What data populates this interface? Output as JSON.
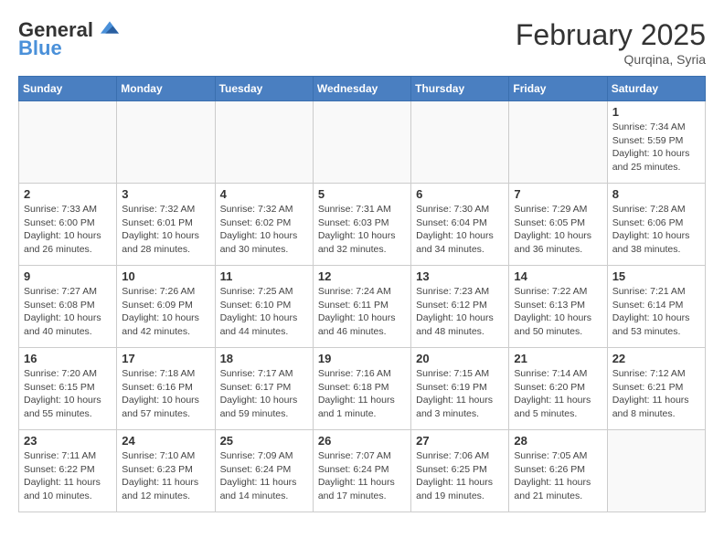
{
  "header": {
    "logo_line1": "General",
    "logo_line2": "Blue",
    "month_title": "February 2025",
    "location": "Qurqina, Syria"
  },
  "weekdays": [
    "Sunday",
    "Monday",
    "Tuesday",
    "Wednesday",
    "Thursday",
    "Friday",
    "Saturday"
  ],
  "weeks": [
    [
      {
        "day": "",
        "info": ""
      },
      {
        "day": "",
        "info": ""
      },
      {
        "day": "",
        "info": ""
      },
      {
        "day": "",
        "info": ""
      },
      {
        "day": "",
        "info": ""
      },
      {
        "day": "",
        "info": ""
      },
      {
        "day": "1",
        "info": "Sunrise: 7:34 AM\nSunset: 5:59 PM\nDaylight: 10 hours and 25 minutes."
      }
    ],
    [
      {
        "day": "2",
        "info": "Sunrise: 7:33 AM\nSunset: 6:00 PM\nDaylight: 10 hours and 26 minutes."
      },
      {
        "day": "3",
        "info": "Sunrise: 7:32 AM\nSunset: 6:01 PM\nDaylight: 10 hours and 28 minutes."
      },
      {
        "day": "4",
        "info": "Sunrise: 7:32 AM\nSunset: 6:02 PM\nDaylight: 10 hours and 30 minutes."
      },
      {
        "day": "5",
        "info": "Sunrise: 7:31 AM\nSunset: 6:03 PM\nDaylight: 10 hours and 32 minutes."
      },
      {
        "day": "6",
        "info": "Sunrise: 7:30 AM\nSunset: 6:04 PM\nDaylight: 10 hours and 34 minutes."
      },
      {
        "day": "7",
        "info": "Sunrise: 7:29 AM\nSunset: 6:05 PM\nDaylight: 10 hours and 36 minutes."
      },
      {
        "day": "8",
        "info": "Sunrise: 7:28 AM\nSunset: 6:06 PM\nDaylight: 10 hours and 38 minutes."
      }
    ],
    [
      {
        "day": "9",
        "info": "Sunrise: 7:27 AM\nSunset: 6:08 PM\nDaylight: 10 hours and 40 minutes."
      },
      {
        "day": "10",
        "info": "Sunrise: 7:26 AM\nSunset: 6:09 PM\nDaylight: 10 hours and 42 minutes."
      },
      {
        "day": "11",
        "info": "Sunrise: 7:25 AM\nSunset: 6:10 PM\nDaylight: 10 hours and 44 minutes."
      },
      {
        "day": "12",
        "info": "Sunrise: 7:24 AM\nSunset: 6:11 PM\nDaylight: 10 hours and 46 minutes."
      },
      {
        "day": "13",
        "info": "Sunrise: 7:23 AM\nSunset: 6:12 PM\nDaylight: 10 hours and 48 minutes."
      },
      {
        "day": "14",
        "info": "Sunrise: 7:22 AM\nSunset: 6:13 PM\nDaylight: 10 hours and 50 minutes."
      },
      {
        "day": "15",
        "info": "Sunrise: 7:21 AM\nSunset: 6:14 PM\nDaylight: 10 hours and 53 minutes."
      }
    ],
    [
      {
        "day": "16",
        "info": "Sunrise: 7:20 AM\nSunset: 6:15 PM\nDaylight: 10 hours and 55 minutes."
      },
      {
        "day": "17",
        "info": "Sunrise: 7:18 AM\nSunset: 6:16 PM\nDaylight: 10 hours and 57 minutes."
      },
      {
        "day": "18",
        "info": "Sunrise: 7:17 AM\nSunset: 6:17 PM\nDaylight: 10 hours and 59 minutes."
      },
      {
        "day": "19",
        "info": "Sunrise: 7:16 AM\nSunset: 6:18 PM\nDaylight: 11 hours and 1 minute."
      },
      {
        "day": "20",
        "info": "Sunrise: 7:15 AM\nSunset: 6:19 PM\nDaylight: 11 hours and 3 minutes."
      },
      {
        "day": "21",
        "info": "Sunrise: 7:14 AM\nSunset: 6:20 PM\nDaylight: 11 hours and 5 minutes."
      },
      {
        "day": "22",
        "info": "Sunrise: 7:12 AM\nSunset: 6:21 PM\nDaylight: 11 hours and 8 minutes."
      }
    ],
    [
      {
        "day": "23",
        "info": "Sunrise: 7:11 AM\nSunset: 6:22 PM\nDaylight: 11 hours and 10 minutes."
      },
      {
        "day": "24",
        "info": "Sunrise: 7:10 AM\nSunset: 6:23 PM\nDaylight: 11 hours and 12 minutes."
      },
      {
        "day": "25",
        "info": "Sunrise: 7:09 AM\nSunset: 6:24 PM\nDaylight: 11 hours and 14 minutes."
      },
      {
        "day": "26",
        "info": "Sunrise: 7:07 AM\nSunset: 6:24 PM\nDaylight: 11 hours and 17 minutes."
      },
      {
        "day": "27",
        "info": "Sunrise: 7:06 AM\nSunset: 6:25 PM\nDaylight: 11 hours and 19 minutes."
      },
      {
        "day": "28",
        "info": "Sunrise: 7:05 AM\nSunset: 6:26 PM\nDaylight: 11 hours and 21 minutes."
      },
      {
        "day": "",
        "info": ""
      }
    ]
  ]
}
